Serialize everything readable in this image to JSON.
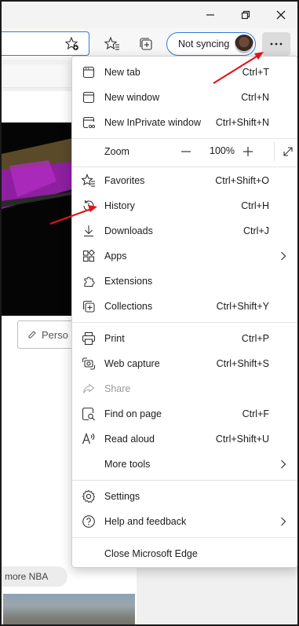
{
  "window": {
    "minimize_icon": "minimize-icon",
    "restore_icon": "restore-icon",
    "close_icon": "close-icon"
  },
  "toolbar": {
    "sync_label": "Not syncing",
    "more_icon": "more-options-icon"
  },
  "page": {
    "person_button_label": "Perso",
    "nba_pill_label": "more NBA"
  },
  "menu": {
    "items": [
      {
        "label": "New tab",
        "shortcut": "Ctrl+T",
        "icon": "new-tab-icon"
      },
      {
        "label": "New window",
        "shortcut": "Ctrl+N",
        "icon": "new-window-icon"
      },
      {
        "label": "New InPrivate window",
        "shortcut": "Ctrl+Shift+N",
        "icon": "inprivate-icon"
      },
      {
        "label": "Zoom",
        "value": "100%"
      },
      {
        "label": "Favorites",
        "shortcut": "Ctrl+Shift+O",
        "icon": "favorites-icon"
      },
      {
        "label": "History",
        "shortcut": "Ctrl+H",
        "icon": "history-icon"
      },
      {
        "label": "Downloads",
        "shortcut": "Ctrl+J",
        "icon": "downloads-icon"
      },
      {
        "label": "Apps",
        "shortcut": "",
        "icon": "apps-icon"
      },
      {
        "label": "Extensions",
        "shortcut": "",
        "icon": "extensions-icon"
      },
      {
        "label": "Collections",
        "shortcut": "Ctrl+Shift+Y",
        "icon": "collections-icon"
      },
      {
        "label": "Print",
        "shortcut": "Ctrl+P",
        "icon": "print-icon"
      },
      {
        "label": "Web capture",
        "shortcut": "Ctrl+Shift+S",
        "icon": "web-capture-icon"
      },
      {
        "label": "Share",
        "shortcut": "",
        "icon": "share-icon"
      },
      {
        "label": "Find on page",
        "shortcut": "Ctrl+F",
        "icon": "find-icon"
      },
      {
        "label": "Read aloud",
        "shortcut": "Ctrl+Shift+U",
        "icon": "read-aloud-icon"
      },
      {
        "label": "More tools",
        "shortcut": ""
      },
      {
        "label": "Settings",
        "shortcut": "",
        "icon": "settings-icon"
      },
      {
        "label": "Help and feedback",
        "shortcut": "",
        "icon": "help-icon"
      },
      {
        "label": "Close Microsoft Edge",
        "shortcut": ""
      }
    ]
  },
  "colors": {
    "accent": "#2f7ad8",
    "annotation_arrow": "#e0141a",
    "menu_bg": "#ffffff",
    "chrome_bg": "#f3f3f3"
  }
}
